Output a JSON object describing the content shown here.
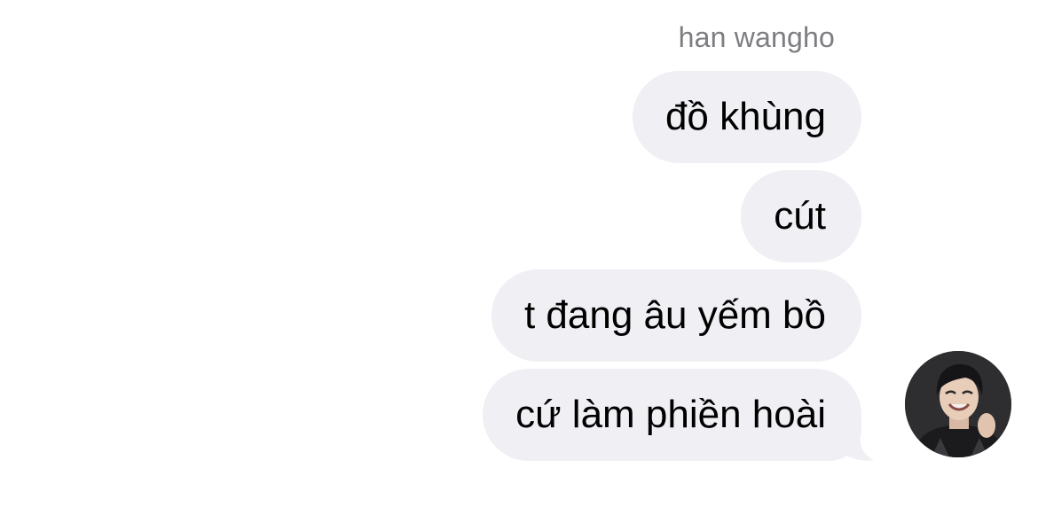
{
  "conversation": {
    "sender_name": "han wangho",
    "messages": [
      {
        "text": "đồ khùng"
      },
      {
        "text": "cút"
      },
      {
        "text": "t đang âu yếm bồ"
      },
      {
        "text": "cứ làm phiền hoài"
      }
    ]
  },
  "avatar": {
    "icon": "profile-photo-icon"
  },
  "colors": {
    "bubble_background": "#efeff4",
    "sender_name": "#7d7d82",
    "message_text": "#000000"
  }
}
